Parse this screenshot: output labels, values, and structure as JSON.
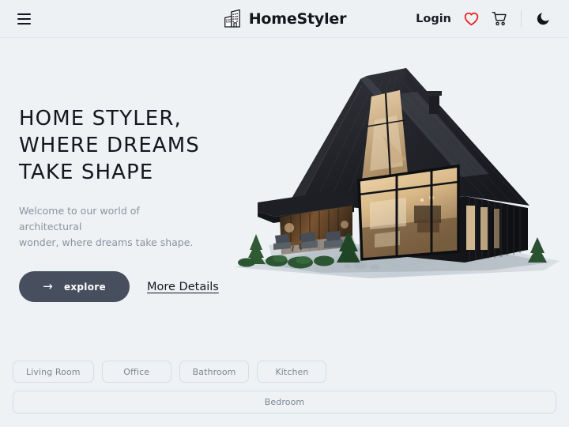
{
  "theme": {
    "page_bg": "#eef2f5",
    "header_bg": "#edf1f4",
    "accent_button": "#474e5e",
    "heart_red": "#ee1111",
    "text_dark": "#14171d",
    "text_muted": "#8a939c",
    "chip_border": "#d7dde3"
  },
  "header": {
    "menu_icon": "hamburger-menu-icon",
    "brand": {
      "icon": "building-logo-icon",
      "name": "HomeStyler"
    },
    "login_label": "Login",
    "wishlist_icon": "heart-icon",
    "cart_icon": "shopping-cart-icon",
    "theme_toggle_icon": "moon-icon"
  },
  "hero": {
    "title": "HOME STYLER,\nWHERE DREAMS\nTAKE SHAPE",
    "subtitle": "Welcome to our world of architectural\nwonder, where dreams take shape.",
    "primary_button": {
      "label": "explore",
      "arrow": "→"
    },
    "secondary_link": "More Details",
    "image_alt": "modern-dark-a-frame-house"
  },
  "categories": {
    "items": [
      {
        "label": "Living Room",
        "full_width": false
      },
      {
        "label": "Office",
        "full_width": false
      },
      {
        "label": "Bathroom",
        "full_width": false
      },
      {
        "label": "Kitchen",
        "full_width": false
      },
      {
        "label": "Bedroom",
        "full_width": true
      }
    ]
  }
}
